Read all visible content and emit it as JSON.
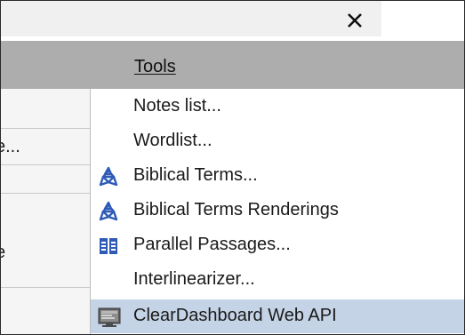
{
  "window": {
    "close_glyph": "✕"
  },
  "menubar": {
    "tools_label": "Tools"
  },
  "background": {
    "fragments": [
      "e...",
      "e"
    ]
  },
  "menu": {
    "items": [
      {
        "label": "Notes list...",
        "icon": "none"
      },
      {
        "label": "Wordlist...",
        "icon": "none"
      },
      {
        "label": "Biblical Terms...",
        "icon": "biblical-terms-icon"
      },
      {
        "label": "Biblical Terms Renderings",
        "icon": "biblical-terms-renderings-icon"
      },
      {
        "label": "Parallel Passages...",
        "icon": "parallel-passages-icon"
      },
      {
        "label": "Interlinearizer...",
        "icon": "none"
      },
      {
        "label": "ClearDashboard Web API",
        "icon": "monitor-icon",
        "selected": true
      }
    ]
  },
  "colors": {
    "menu_header_bg": "#adadad",
    "selected_item_bg": "#c4d3e6",
    "icon_blue": "#2f5bb7"
  }
}
